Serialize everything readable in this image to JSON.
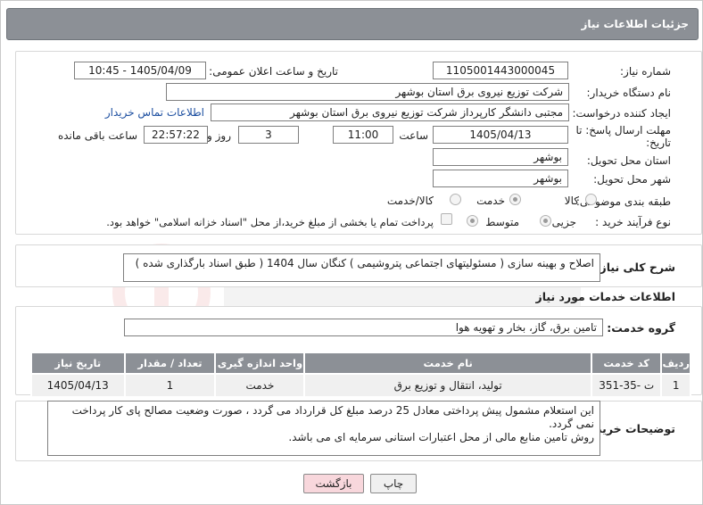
{
  "header": {
    "title": "جزئیات اطلاعات نیاز"
  },
  "form": {
    "need_number_label": "شماره نیاز:",
    "need_number": "1105001443000045",
    "announce_label": "تاریخ و ساعت اعلان عمومی:",
    "announce_value": "1405/04/09 - 10:45",
    "buyer_org_label": "نام دستگاه خریدار:",
    "buyer_org": "شرکت توزیع نیروی برق استان بوشهر",
    "creator_label": "ایجاد کننده درخواست:",
    "creator": "مجتبی دانشگر کارپرداز شرکت توزیع نیروی برق استان بوشهر",
    "contact_link": "اطلاعات تماس خریدار",
    "deadline_label": "مهلت ارسال پاسخ: تا تاریخ:",
    "deadline_date": "1405/04/13",
    "time_label": "ساعت",
    "deadline_time": "11:00",
    "days_count": "3",
    "days_label": "روز و",
    "remaining_time": "22:57:22",
    "remaining_label": "ساعت باقی مانده",
    "province_label": "استان محل تحویل:",
    "province": "بوشهر",
    "city_label": "شهر محل تحویل:",
    "city": "بوشهر",
    "category_label": "طبقه بندی موضوعی:",
    "category_options": [
      "کالا",
      "خدمت",
      "کالا/خدمت"
    ],
    "process_label": "نوع فرآیند خرید :",
    "process_options": [
      "جزیی",
      "متوسط"
    ],
    "payment_note": "پرداخت تمام یا بخشی از مبلغ خرید،از محل \"اسناد خزانه اسلامی\" خواهد بود."
  },
  "summary": {
    "label": "شرح کلی نیاز:",
    "text": "اصلاح و بهینه سازی ( مسئولیتهای اجتماعی پتروشیمی ) کنگان سال 1404 ( طبق اسناد بارگذاری شده )"
  },
  "services": {
    "section_title": "اطلاعات خدمات مورد نیاز",
    "group_label": "گروه خدمت:",
    "group_value": "تامین برق، گاز، بخار و تهویه هوا",
    "columns": [
      "ردیف",
      "کد خدمت",
      "نام خدمت",
      "واحد اندازه گیری",
      "تعداد / مقدار",
      "تاریخ نیاز"
    ],
    "rows": [
      [
        "1",
        "ت -35-351",
        "تولید، انتقال و توزیع برق",
        "خدمت",
        "1",
        "1405/04/13"
      ]
    ]
  },
  "notes": {
    "label": "توضیحات خریدار:",
    "line1": "این استعلام مشمول پیش پرداختی معادل 25 درصد مبلغ کل قرارداد می گردد ، صورت وضعیت مصالح پای کار پرداخت",
    "line2": "نمی گردد.",
    "line3": "روش تامین منابع مالی از محل اعتبارات استانی سرمایه ای می باشد."
  },
  "buttons": {
    "print": "چاپ",
    "back": "بازگشت"
  },
  "colors": {
    "header_bg": "#8c9096",
    "link": "#1d4fa0",
    "back_btn_bg": "#f8d7dc"
  }
}
